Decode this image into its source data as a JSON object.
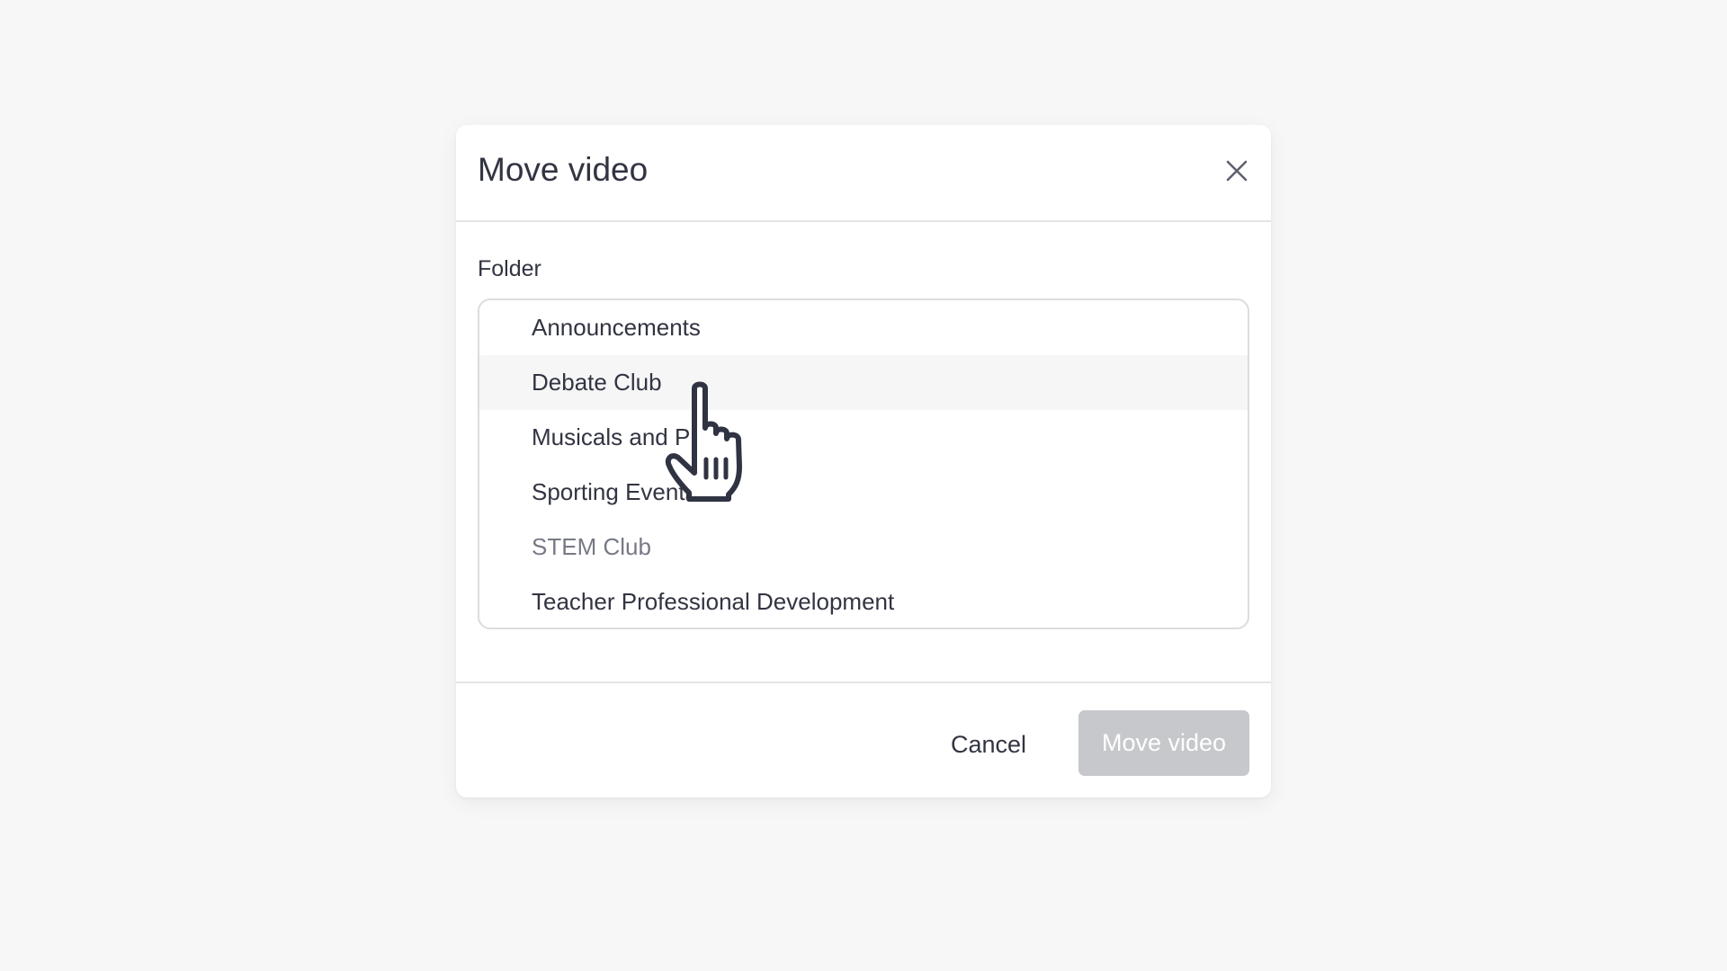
{
  "dialog": {
    "title": "Move video",
    "close_icon": "close-icon"
  },
  "folder_field": {
    "label": "Folder",
    "options": [
      {
        "label": "Announcements",
        "state": "normal"
      },
      {
        "label": "Debate Club",
        "state": "hover"
      },
      {
        "label": "Musicals and Plays",
        "state": "normal"
      },
      {
        "label": "Sporting Events",
        "state": "normal"
      },
      {
        "label": "STEM Club",
        "state": "muted"
      },
      {
        "label": "Teacher Professional Development",
        "state": "normal"
      }
    ]
  },
  "footer": {
    "cancel_label": "Cancel",
    "submit_label": "Move video",
    "submit_disabled": true
  },
  "colors": {
    "background": "#f7f7f7",
    "text": "#323442",
    "muted_text": "#777985",
    "hover_row": "#f6f6f6",
    "disabled_button": "#c7c8cc"
  },
  "cursor": {
    "icon": "hand-pointer-icon"
  }
}
